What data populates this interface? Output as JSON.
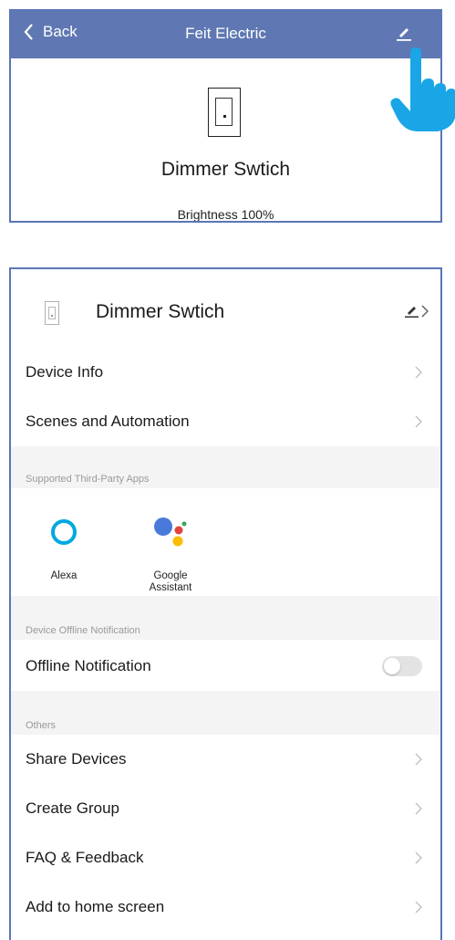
{
  "nav": {
    "back_label": "Back",
    "title": "Feit Electric",
    "edit_icon": "pencil-icon"
  },
  "device": {
    "name": "Dimmer Swtich",
    "brightness_text": "Brightness 100%",
    "brightness_value": 100
  },
  "settings": {
    "header_name": "Dimmer Swtich",
    "device_info_label": "Device Info",
    "scenes_label": "Scenes and Automation",
    "third_party_title": "Supported Third-Party Apps",
    "apps": [
      {
        "name": "Alexa",
        "icon": "alexa-icon"
      },
      {
        "name": "Google Assistant",
        "icon": "google-assistant-icon"
      }
    ],
    "offline_section_title": "Device Offline Notification",
    "offline_label": "Offline Notification",
    "offline_enabled": false,
    "others_title": "Others",
    "others": [
      {
        "label": "Share Devices"
      },
      {
        "label": "Create Group"
      },
      {
        "label": "FAQ & Feedback"
      },
      {
        "label": "Add to home screen"
      }
    ]
  },
  "colors": {
    "nav_bar": "#5f78b3",
    "card_border": "#5a76b8",
    "alexa": "#00a8e1",
    "hand_cursor": "#1aa6e6"
  }
}
